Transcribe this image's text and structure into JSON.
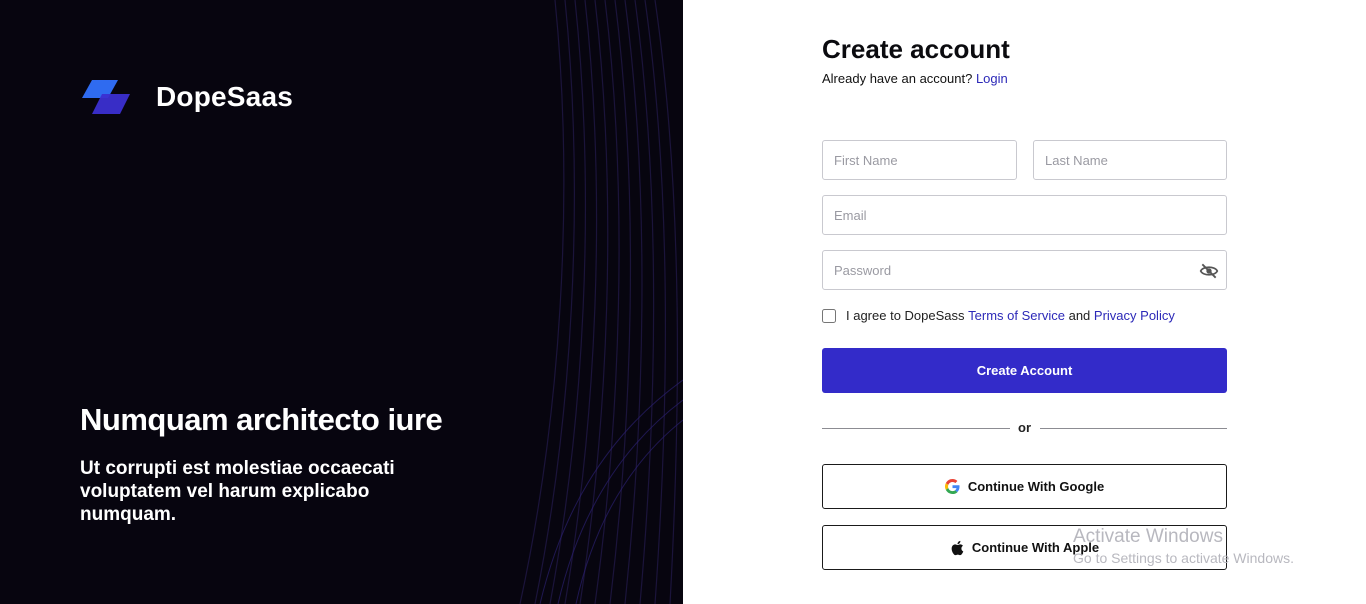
{
  "brand": {
    "name": "DopeSaas",
    "logo_colors": [
      "#2f6bf0",
      "#3b2fd1"
    ]
  },
  "hero": {
    "title": "Numquam architecto iure",
    "subtitle": "Ut corrupti est molestiae occaecati voluptatem vel harum explicabo numquam."
  },
  "form": {
    "title": "Create account",
    "have_account_text": "Already have an account?",
    "login_link": "Login",
    "first_name_placeholder": "First Name",
    "last_name_placeholder": "Last Name",
    "email_placeholder": "Email",
    "password_placeholder": "Password",
    "password_toggle_icon": "eye-off-icon",
    "agree_prefix": "I agree to DopeSass",
    "terms_link": "Terms of Service",
    "agree_and": "and",
    "privacy_link": "Privacy Policy",
    "submit_label": "Create Account",
    "divider_text": "or",
    "google_label": "Continue With Google",
    "apple_label": "Continue With Apple"
  },
  "watermark": {
    "line1": "Activate Windows",
    "line2": "Go to Settings to activate Windows."
  },
  "colors": {
    "accent": "#332bc9",
    "link": "#2c29b8",
    "left_bg": "#07050f"
  }
}
